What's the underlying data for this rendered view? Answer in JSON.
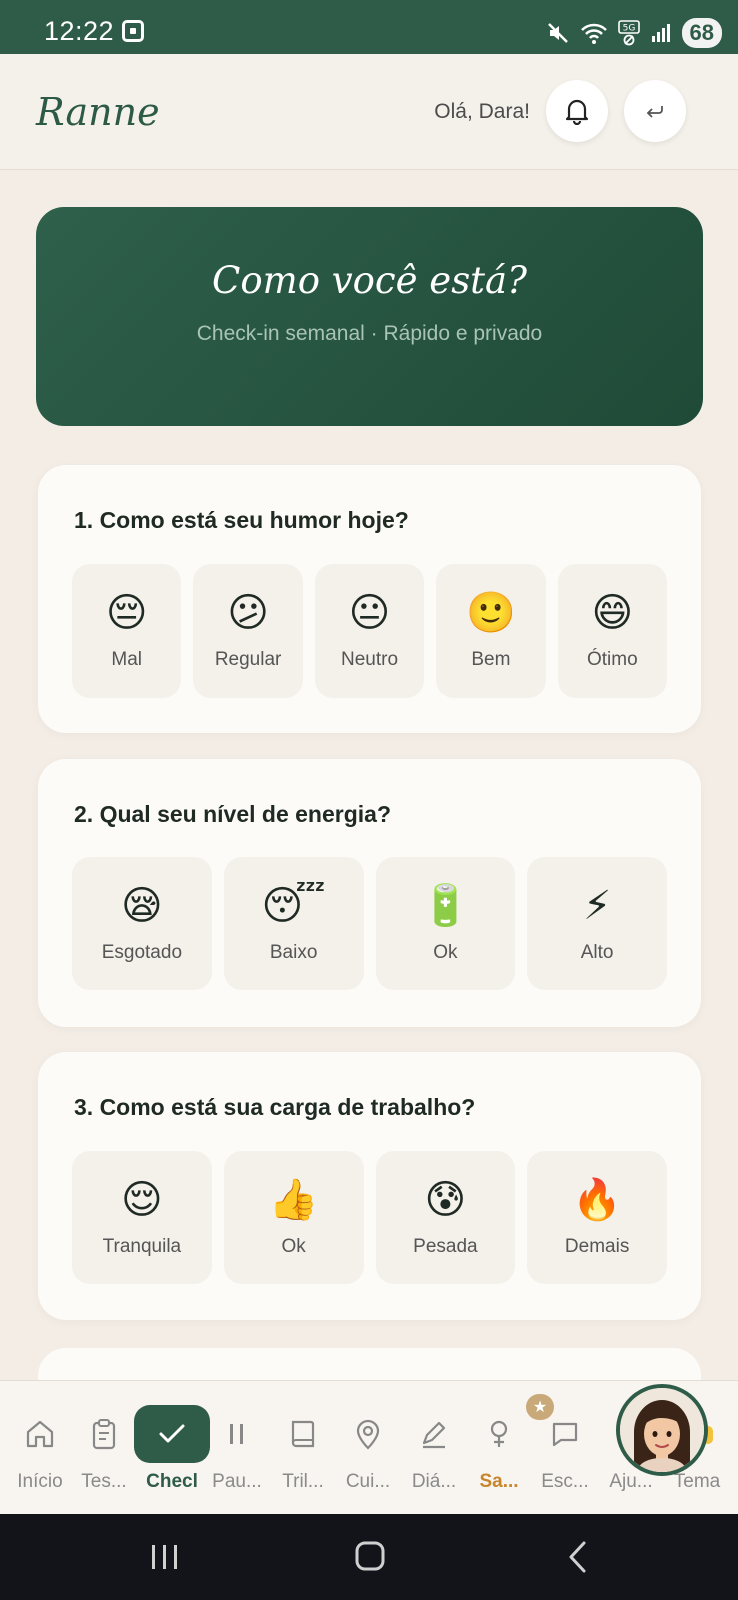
{
  "status_bar": {
    "time": "12:22",
    "battery": "68"
  },
  "header": {
    "logo": "Ranne",
    "greeting": "Olá, Dara!"
  },
  "hero": {
    "title": "Como você está?",
    "subtitle": "Check-in semanal · Rápido e privado"
  },
  "questions": [
    {
      "title": "1. Como está seu humor hoje?",
      "options": [
        {
          "emoji": "😔",
          "label": "Mal"
        },
        {
          "emoji": "😕",
          "label": "Regular"
        },
        {
          "emoji": "😐",
          "label": "Neutro"
        },
        {
          "emoji": "🙂",
          "label": "Bem"
        },
        {
          "emoji": "😄",
          "label": "Ótimo"
        }
      ]
    },
    {
      "title": "2. Qual seu nível de energia?",
      "options": [
        {
          "emoji": "😪",
          "label": "Esgotado"
        },
        {
          "emoji": "😴",
          "label": "Baixo"
        },
        {
          "emoji": "🔋",
          "label": "Ok"
        },
        {
          "emoji": "⚡",
          "label": "Alto"
        }
      ]
    },
    {
      "title": "3. Como está sua carga de trabalho?",
      "options": [
        {
          "emoji": "😌",
          "label": "Tranquila"
        },
        {
          "emoji": "👍",
          "label": "Ok"
        },
        {
          "emoji": "😰",
          "label": "Pesada"
        },
        {
          "emoji": "🔥",
          "label": "Demais"
        }
      ]
    }
  ],
  "nav": {
    "items": [
      {
        "label": "Início",
        "icon": "home-icon"
      },
      {
        "label": "Tes...",
        "icon": "clipboard-icon"
      },
      {
        "label": "Checl",
        "icon": "check-icon",
        "active": true
      },
      {
        "label": "Pau...",
        "icon": "pause-icon"
      },
      {
        "label": "Tril...",
        "icon": "book-icon"
      },
      {
        "label": "Cui...",
        "icon": "map-pin-icon"
      },
      {
        "label": "Diá...",
        "icon": "pencil-icon"
      },
      {
        "label": "Sa...",
        "icon": "female-icon"
      },
      {
        "label": "Esc...",
        "icon": "chat-icon"
      },
      {
        "label": "Aju...",
        "icon": "help-icon"
      },
      {
        "label": "Tema",
        "icon": "theme-icon"
      }
    ],
    "badge": "★"
  }
}
